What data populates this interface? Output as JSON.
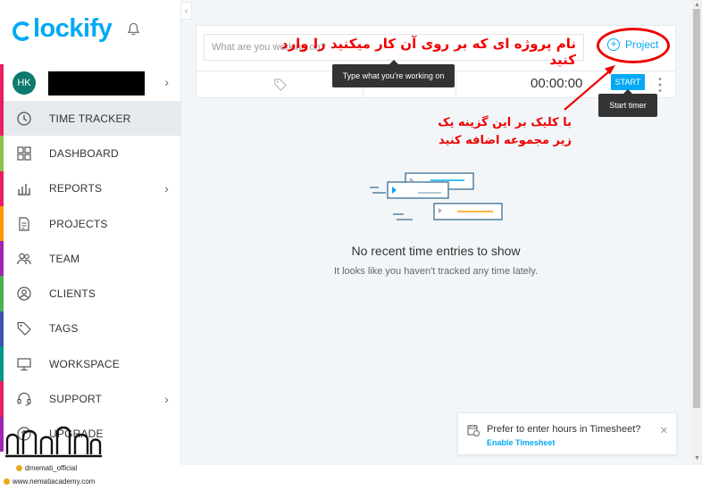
{
  "app": {
    "logo_text": "lockify"
  },
  "workspace": {
    "avatar": "HK"
  },
  "nav": {
    "items": [
      {
        "label": "TIME TRACKER",
        "icon": "clock-icon",
        "bar": "#e91e63"
      },
      {
        "label": "DASHBOARD",
        "icon": "dashboard-icon",
        "bar": "#8bc34a"
      },
      {
        "label": "REPORTS",
        "icon": "reports-icon",
        "bar": "#e91e63"
      },
      {
        "label": "PROJECTS",
        "icon": "projects-icon",
        "bar": "#ff9800"
      },
      {
        "label": "TEAM",
        "icon": "team-icon",
        "bar": "#9c27b0"
      },
      {
        "label": "CLIENTS",
        "icon": "clients-icon",
        "bar": "#4caf50"
      },
      {
        "label": "TAGS",
        "icon": "tag-icon",
        "bar": "#3f51b5"
      },
      {
        "label": "WORKSPACE",
        "icon": "workspace-icon",
        "bar": "#009688"
      },
      {
        "label": "SUPPORT",
        "icon": "support-icon",
        "bar": "#e91e63"
      },
      {
        "label": "UPGRADE",
        "icon": "upgrade-icon",
        "bar": "#9c27b0"
      }
    ]
  },
  "tracker": {
    "placeholder": "What are you working on?",
    "project_label": "Project",
    "timer": "00:00:00",
    "start_label": "START",
    "tooltip_input": "Type what you're working on",
    "tooltip_start": "Start timer"
  },
  "empty": {
    "title": "No recent time entries to show",
    "subtitle": "It looks like you haven't tracked any time lately."
  },
  "annotations": {
    "top": "نام پروژه ای که بر روی آن کار میکنید را وارد کنید",
    "side_line1": "با کلیک بر این گزینه یک",
    "side_line2": "زیر مجموعه اضافه کنید",
    "color": "#ee0000"
  },
  "notification": {
    "text": "Prefer to enter hours in Timesheet?",
    "link": "Enable Timesheet"
  },
  "watermark": {
    "instagram": "drnemati_official",
    "website": "www.nematiacademy.com"
  },
  "colors": {
    "accent": "#03a9f4",
    "sidebar_active": "#e4eaee"
  }
}
